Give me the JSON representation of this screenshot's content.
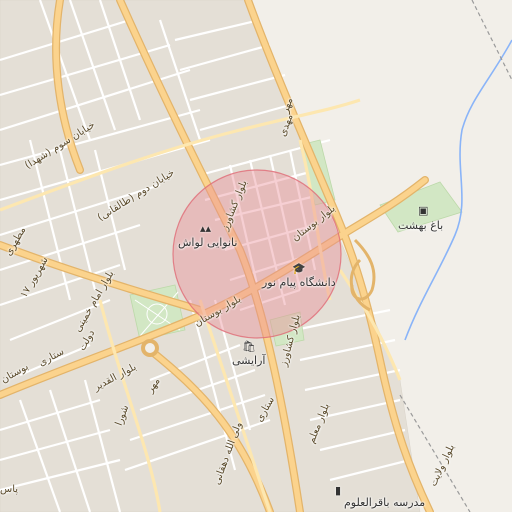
{
  "map": {
    "road_labels": {
      "boulevard_keshavarz_north": "بلوار کشاورز",
      "boulevard_keshavarz_south": "بلوار کشاورز",
      "boulevard_bustan_east": "بلوار بوستان",
      "boulevard_bustan_west": "بلوار بوستان",
      "boulevard_emam_khomeini": "بلوار امام خمینی",
      "boulevard_ghadir": "بلوار القدیر",
      "boulevard_moalem": "بلوار معلم",
      "boulevard_velayat": "بلوار ولایت",
      "street_sattari": "ستاری",
      "street_sattari_2": "ستاری",
      "street_dolat": "دولت",
      "street_mehr": "مهر",
      "street_shora": "شورا",
      "street_mahdi": "مهدی",
      "street_mehr_2": "مهر",
      "khiaban_sevom": "خیابان سوم (شهدا)",
      "khiaban_dovom": "خیابان دوم (طالقانی)",
      "street_17_shahrivar": "۱۷ شهریور",
      "street_motahari": "مطهری",
      "street_valiallah": "ولی الله دهقانی",
      "street_bustan_edge": "بوستان",
      "street_pas": "پاس"
    },
    "pois": {
      "bakery": "نانوایی لواش",
      "university": "دانشگاه پیام نور",
      "beauty_salon": "آرایشی",
      "garden": "باغ بهشت",
      "school": "مدرسه باقرالعلوم"
    },
    "icons": {
      "bakery": "bakery-icon",
      "university": "graduation-cap-icon",
      "beauty_salon": "shopping-bag-icon",
      "garden": "garden-icon",
      "school": "school-icon"
    },
    "colors": {
      "background": "#f2efe9",
      "major_road": "#fbd38d",
      "major_road_casing": "#e8b86a",
      "minor_road": "#ffffff",
      "block": "#e2ddd5",
      "park": "#cde6c0",
      "water": "#8ab4f8",
      "highlight_circle": "#e88890"
    }
  }
}
